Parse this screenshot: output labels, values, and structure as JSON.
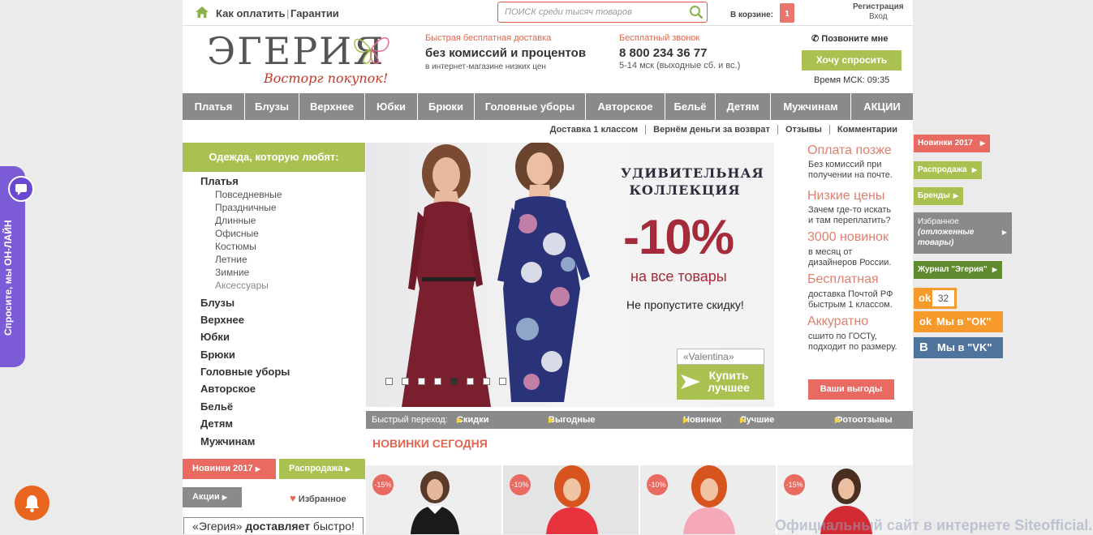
{
  "topbar": {
    "how_to_pay": "Как оплатить",
    "guarantees": "Гарантии",
    "search_placeholder": "ПОИСК среди тысяч товаров",
    "cart_label": "В корзине:",
    "cart_count": "1",
    "register": "Регистрация",
    "login": "Вход"
  },
  "header": {
    "logo": "ЭГЕРИЯ",
    "slogan": "Восторг покупок!",
    "delivery_small": "Быстрая бесплатная доставка",
    "delivery_big": "без комиссий и процентов",
    "delivery_sub": "в интернет-магазине низких цен",
    "call_small": "Бесплатный звонок",
    "call_big": "8 800 234 36 77",
    "call_sub": "5-14 мск (выходные сб. и вс.)",
    "callme": "Позвоните мне",
    "want_button": "Хочу спросить",
    "time": "Время МСК: 09:35"
  },
  "nav": [
    "Платья",
    "Блузы",
    "Верхнее",
    "Юбки",
    "Брюки",
    "Головные уборы",
    "Авторское",
    "Бельё",
    "Детям",
    "Мужчинам",
    "АКЦИИ"
  ],
  "subnav": [
    "Доставка 1 классом",
    "Вернём деньги за возврат",
    "Отзывы",
    "Комментарии"
  ],
  "sidebar": {
    "heading": "Одежда, которую любят:",
    "dresses": "Платья",
    "dress_subs": [
      "Повседневные",
      "Праздничные",
      "Длинные",
      "Офисные",
      "Костюмы",
      "Летние",
      "Зимние",
      "Аксессуары"
    ],
    "categories": [
      "Блузы",
      "Верхнее",
      "Юбки",
      "Брюки",
      "Головные уборы",
      "Авторское",
      "Бельё",
      "Детям",
      "Мужчинам"
    ],
    "btn_new": "Новинки 2017",
    "btn_sale": "Распродажа",
    "btn_actions": "Акции",
    "favorites": "Избранное",
    "delivery_pre": "«Эгерия»",
    "delivery_bold": "доставляет",
    "delivery_post": "быстро!"
  },
  "banner": {
    "title": "УДИВИТЕЛЬНАЯ КОЛЛЕКЦИЯ",
    "percent": "-10%",
    "all": "на все товары",
    "miss": "Не пропустите скидку!",
    "brand": "«Valentina»",
    "buy": "Купить лучшее",
    "slides": 8,
    "active_slide": 5
  },
  "advantages": [
    {
      "title": "Оплата позже",
      "text": [
        "Без комиссий при",
        "получении на почте."
      ]
    },
    {
      "title": "Низкие цены",
      "text": [
        "Зачем где-то искать",
        "и там переплатить?"
      ]
    },
    {
      "title": "3000 новинок",
      "text": [
        "в месяц от",
        "дизайнеров России."
      ]
    },
    {
      "title": "Бесплатная",
      "text": [
        "доставка Почтой РФ",
        "быстрым 1 классом."
      ]
    },
    {
      "title": "Аккуратно",
      "text": [
        "сшито по ГОСТу,",
        "подходит по размеру."
      ]
    }
  ],
  "benefits_button": "Ваши выгоды",
  "quick": {
    "label": "Быстрый переход:",
    "links": [
      "Скидки сегодня",
      "Выгодные предложения",
      "Новинки",
      "Лучшие акции",
      "Фотоотзывы"
    ]
  },
  "new_today": "НОВИНКИ СЕГОДНЯ",
  "products": [
    {
      "discount": "-15%"
    },
    {
      "discount": "-10%"
    },
    {
      "discount": "-10%"
    },
    {
      "discount": "-15%"
    }
  ],
  "right_tabs": {
    "new": "Новинки 2017",
    "sale": "Распродажа",
    "brands": "Бренды",
    "fav_line1": "Избранное",
    "fav_line2": "(отложенные",
    "fav_line3": "товары)",
    "journal": "Журнал \"Эгерия\"",
    "ok_count": "32",
    "ok": "Мы в \"ОК\"",
    "vk": "Мы в \"VK\""
  },
  "online": "Спросите, мы ОН-ЛАЙН",
  "watermark": "Официальный сайт в интернете Siteofficial.ru",
  "colors": {
    "green": "#a9c151",
    "coral": "#e96a60",
    "gray_nav": "#8a8a8a",
    "purple": "#7b5cd6"
  }
}
